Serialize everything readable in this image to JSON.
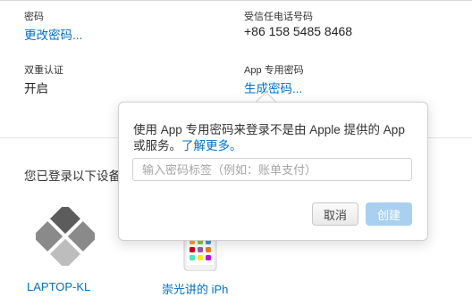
{
  "account": {
    "password": {
      "label": "密码",
      "action": "更改密码..."
    },
    "trusted_phone": {
      "label": "受信任电话号码",
      "value": "+86 158 5485 8468"
    },
    "two_factor": {
      "label": "双重认证",
      "value": "开启"
    },
    "app_password": {
      "label": "App 专用密码",
      "action": "生成密码..."
    }
  },
  "devices": {
    "title": "您已登录以下设备",
    "items": [
      {
        "name": "LAPTOP-KL",
        "icon": "windows-pc-icon"
      },
      {
        "name": "崇光讲的 iPh",
        "icon": "iphone-icon"
      }
    ]
  },
  "popover": {
    "description": "使用 App 专用密码来登录不是由 Apple 提供的 App 或服务。",
    "learn_more": "了解更多。",
    "input_placeholder": "输入密码标签（例如：账单支付）",
    "cancel_label": "取消",
    "create_label": "创建"
  },
  "colors": {
    "link": "#0070c9",
    "create_disabled": "#a9d0ef"
  }
}
